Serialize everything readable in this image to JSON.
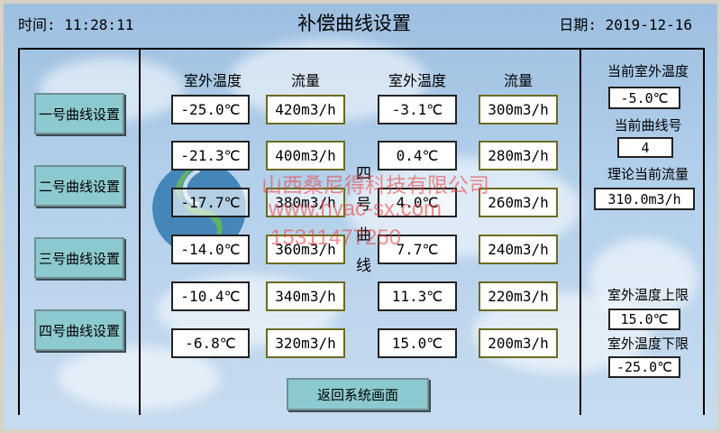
{
  "header": {
    "time": "时间: 11:28:11",
    "title": "补偿曲线设置",
    "date": "日期: 2019-12-16"
  },
  "curve_buttons": [
    {
      "label": "一号曲线设置"
    },
    {
      "label": "二号曲线设置"
    },
    {
      "label": "三号曲线设置"
    },
    {
      "label": "四号曲线设置"
    }
  ],
  "table": {
    "headers": [
      "室外温度",
      "流量",
      "室外温度",
      "流量"
    ],
    "rows": [
      {
        "t1": "-25.0℃",
        "f1": "420m3/h",
        "t2": "-3.1℃",
        "f2": "300m3/h"
      },
      {
        "t1": "-21.3℃",
        "f1": "400m3/h",
        "t2": "0.4℃",
        "f2": "280m3/h"
      },
      {
        "t1": "-17.7℃",
        "f1": "380m3/h",
        "t2": "4.0℃",
        "f2": "260m3/h"
      },
      {
        "t1": "-14.0℃",
        "f1": "360m3/h",
        "t2": "7.7℃",
        "f2": "240m3/h"
      },
      {
        "t1": "-10.4℃",
        "f1": "340m3/h",
        "t2": "11.3℃",
        "f2": "220m3/h"
      },
      {
        "t1": "-6.8℃",
        "f1": "320m3/h",
        "t2": "15.0℃",
        "f2": "200m3/h"
      }
    ],
    "vertical_label": [
      "四",
      "号",
      "曲",
      "线"
    ]
  },
  "side": {
    "current_temp_label": "当前室外温度",
    "current_temp": "-5.0℃",
    "current_curve_label": "当前曲线号",
    "current_curve": "4",
    "theory_flow_label": "理论当前流量",
    "theory_flow": "310.0m3/h",
    "upper_label": "室外温度上限",
    "upper": "15.0℃",
    "lower_label": "室外温度下限",
    "lower": "-25.0℃"
  },
  "back_button": "返回系统画面",
  "watermark": {
    "company": "山西桑尼得科技有限公司",
    "url": "www.hvac-sx.com",
    "phone": "15311477250"
  },
  "colors": {
    "button": "#8dcad0",
    "flow_border": "#6b6b1f",
    "watermark": "#e84646"
  },
  "icons": {
    "logo": "company-logo-icon"
  }
}
